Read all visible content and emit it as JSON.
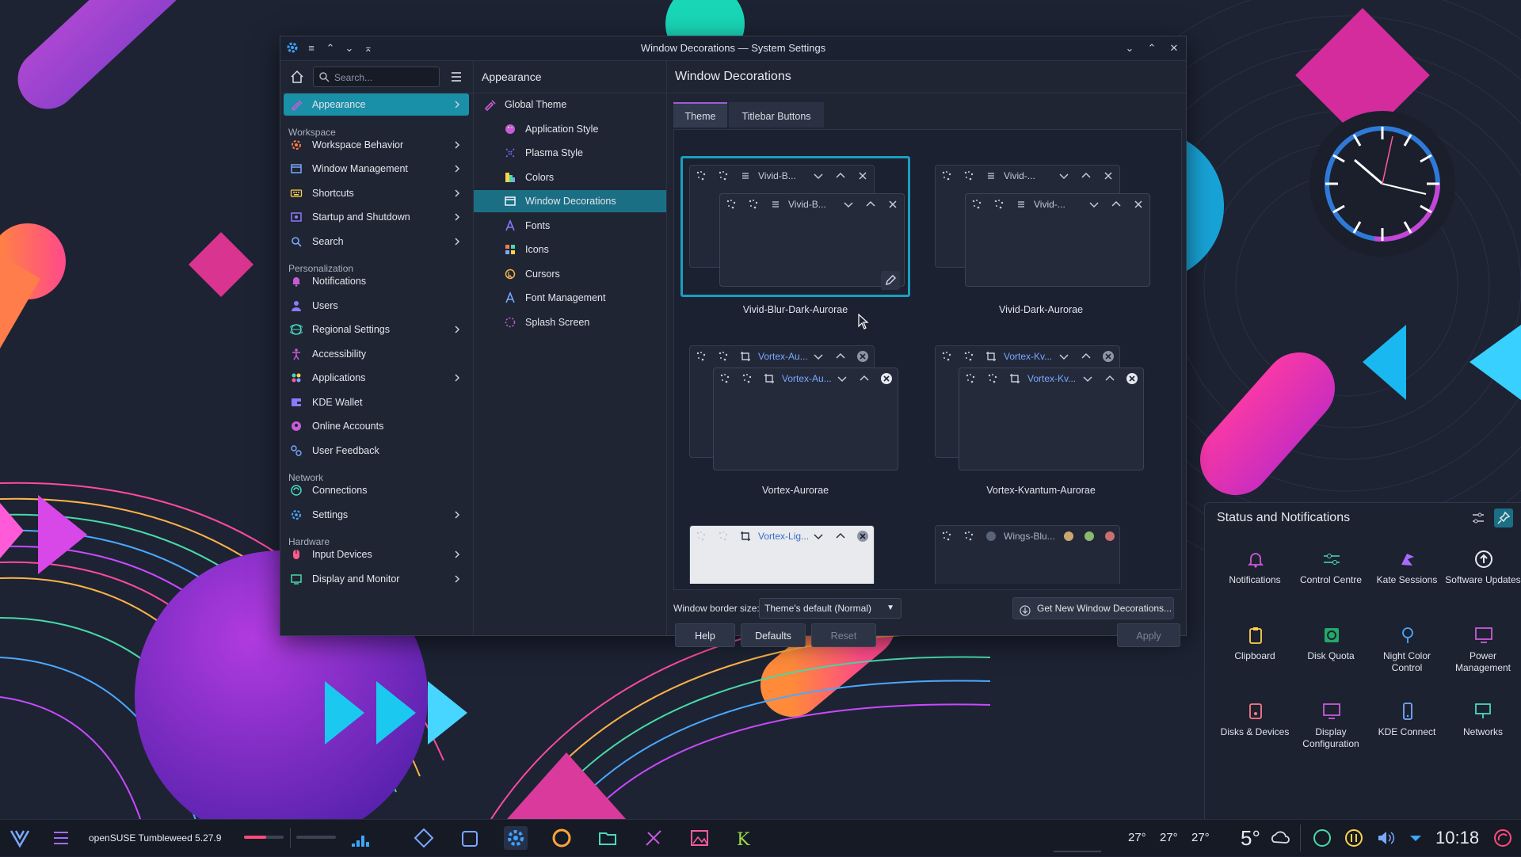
{
  "window": {
    "title": "Window Decorations — System Settings"
  },
  "sidebar": {
    "search_placeholder": "Search...",
    "selected": "Appearance",
    "items": [
      {
        "label": "Appearance",
        "chevron": true
      },
      {
        "section": "Workspace"
      },
      {
        "label": "Workspace Behavior",
        "chevron": true
      },
      {
        "label": "Window Management",
        "chevron": true
      },
      {
        "label": "Shortcuts",
        "chevron": true
      },
      {
        "label": "Startup and Shutdown",
        "chevron": true
      },
      {
        "label": "Search",
        "chevron": true
      },
      {
        "section": "Personalization"
      },
      {
        "label": "Notifications",
        "chevron": false
      },
      {
        "label": "Users",
        "chevron": false
      },
      {
        "label": "Regional Settings",
        "chevron": true
      },
      {
        "label": "Accessibility",
        "chevron": false
      },
      {
        "label": "Applications",
        "chevron": true
      },
      {
        "label": "KDE Wallet",
        "chevron": false
      },
      {
        "label": "Online Accounts",
        "chevron": false
      },
      {
        "label": "User Feedback",
        "chevron": false
      },
      {
        "section": "Network"
      },
      {
        "label": "Connections",
        "chevron": false
      },
      {
        "label": "Settings",
        "chevron": true
      },
      {
        "section": "Hardware"
      },
      {
        "label": "Input Devices",
        "chevron": true
      },
      {
        "label": "Display and Monitor",
        "chevron": true
      }
    ]
  },
  "subnav": {
    "title": "Appearance",
    "selected": "Window Decorations",
    "items": [
      {
        "label": "Global Theme",
        "indent": false
      },
      {
        "label": "Application Style",
        "indent": true
      },
      {
        "label": "Plasma Style",
        "indent": true
      },
      {
        "label": "Colors",
        "indent": true
      },
      {
        "label": "Window Decorations",
        "indent": true
      },
      {
        "label": "Fonts",
        "indent": true
      },
      {
        "label": "Icons",
        "indent": true
      },
      {
        "label": "Cursors",
        "indent": true
      },
      {
        "label": "Font Management",
        "indent": true
      },
      {
        "label": "Splash Screen",
        "indent": true
      }
    ]
  },
  "main": {
    "title": "Window Decorations",
    "tabs": [
      {
        "label": "Theme"
      },
      {
        "label": "Titlebar Buttons"
      }
    ],
    "active_tab": "Theme",
    "themes": [
      {
        "name": "Vivid-Blur-Dark-Aurorae",
        "back_title": "Vivid-B...",
        "front_title": "Vivid-B...",
        "selected": true
      },
      {
        "name": "Vivid-Dark-Aurorae",
        "back_title": "Vivid-...",
        "front_title": "Vivid-...",
        "selected": false
      },
      {
        "name": "Vortex-Aurorae",
        "back_title": "Vortex-Au...",
        "front_title": "Vortex-Au...",
        "selected": false
      },
      {
        "name": "Vortex-Kvantum-Aurorae",
        "back_title": "Vortex-Kv...",
        "front_title": "Vortex-Kv...",
        "selected": false
      },
      {
        "name": "",
        "back_title": "Vortex-Lig...",
        "front_title": "",
        "selected": false
      },
      {
        "name": "",
        "back_title": "Wings-Blu...",
        "front_title": "",
        "selected": false
      }
    ],
    "border_size_label": "Window border size:",
    "border_size_value": "Theme's default (Normal)",
    "get_new_label": "Get New Window Decorations...",
    "buttons": {
      "help": "Help",
      "defaults": "Defaults",
      "reset": "Reset",
      "apply": "Apply"
    }
  },
  "taskbar": {
    "os_label": "openSUSE Tumbleweed 5.27.9",
    "temps": [
      "27°",
      "27°",
      "27°"
    ],
    "weather_temp": "5°",
    "clock": "10:18"
  },
  "popup": {
    "title": "Status and Notifications",
    "applets": [
      {
        "label": "Notifications",
        "icon": "bell-icon"
      },
      {
        "label": "Control Centre",
        "icon": "sliders-icon"
      },
      {
        "label": "Kate Sessions",
        "icon": "kate-icon"
      },
      {
        "label": "Software Updates",
        "icon": "update-icon"
      },
      {
        "label": "Clipboard",
        "icon": "clipboard-icon"
      },
      {
        "label": "Disk Quota",
        "icon": "disk-quota-icon"
      },
      {
        "label": "Night Color Control",
        "icon": "night-color-icon"
      },
      {
        "label": "Power Management",
        "icon": "power-icon"
      },
      {
        "label": "Disks & Devices",
        "icon": "disks-icon"
      },
      {
        "label": "Display Configuration",
        "icon": "display-icon"
      },
      {
        "label": "KDE Connect",
        "icon": "phone-icon"
      },
      {
        "label": "Networks",
        "icon": "network-icon"
      }
    ]
  }
}
